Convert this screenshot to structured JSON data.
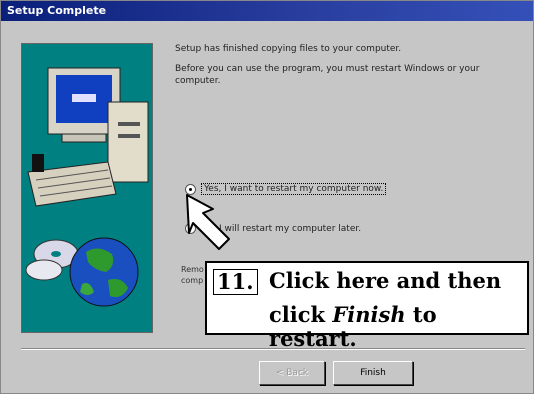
{
  "window": {
    "title": "Setup Complete"
  },
  "content": {
    "line1": "Setup has finished copying files to your computer.",
    "line2": "Before you can use the program, you must restart Windows or your computer."
  },
  "options": {
    "restart_now": "Yes, I want to restart my computer now.",
    "restart_later": "No, I will restart my computer later.",
    "selected": "restart_now"
  },
  "partial_text": {
    "line1": "Remo",
    "line2": "comp"
  },
  "callout": {
    "number": "11.",
    "line1": "Click here and then",
    "line2_prefix": "click ",
    "line2_emphasis": "Finish",
    "line2_suffix": " to restart."
  },
  "buttons": {
    "back": "< Back",
    "finish": "Finish"
  },
  "colors": {
    "titlebar": "#0a1f7a",
    "art_background": "#008080"
  }
}
